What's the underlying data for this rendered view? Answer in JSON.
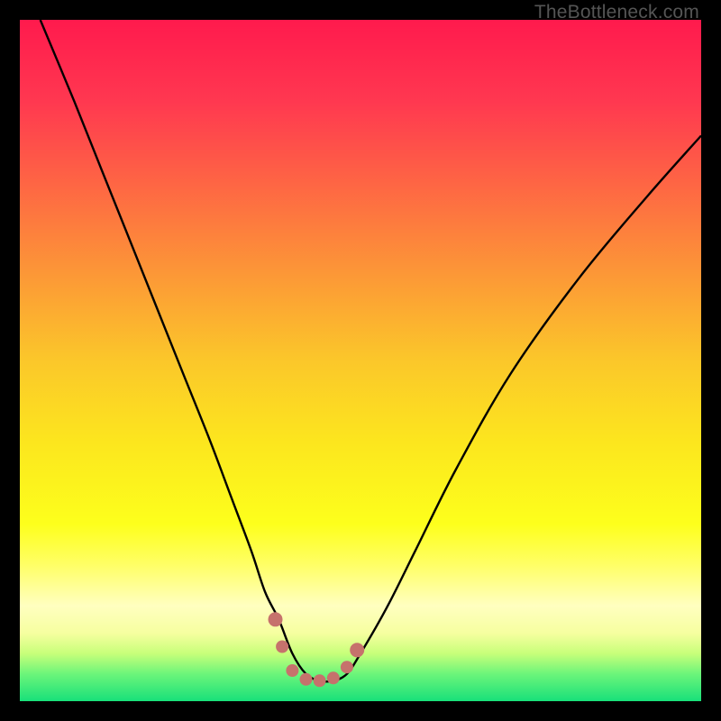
{
  "watermark": "TheBottleneck.com",
  "colors": {
    "frame": "#000000",
    "curve": "#000000",
    "marker": "#C6726C",
    "gradient_stops": [
      {
        "offset": 0.0,
        "color": "#FF1A4D"
      },
      {
        "offset": 0.12,
        "color": "#FF3850"
      },
      {
        "offset": 0.3,
        "color": "#FD7C3E"
      },
      {
        "offset": 0.5,
        "color": "#FBC72A"
      },
      {
        "offset": 0.62,
        "color": "#FCE61E"
      },
      {
        "offset": 0.74,
        "color": "#FDFF1C"
      },
      {
        "offset": 0.8,
        "color": "#FFFF66"
      },
      {
        "offset": 0.86,
        "color": "#FFFFC0"
      },
      {
        "offset": 0.9,
        "color": "#F6FFA0"
      },
      {
        "offset": 0.93,
        "color": "#C8FF7A"
      },
      {
        "offset": 0.96,
        "color": "#6CF57A"
      },
      {
        "offset": 1.0,
        "color": "#18E07A"
      }
    ]
  },
  "chart_data": {
    "type": "line",
    "title": "",
    "xlabel": "",
    "ylabel": "",
    "xlim": [
      0,
      100
    ],
    "ylim": [
      0,
      100
    ],
    "grid": false,
    "legend": false,
    "series": [
      {
        "name": "bottleneck-curve",
        "x": [
          3,
          8,
          12,
          16,
          20,
          24,
          28,
          31,
          34,
          36,
          38,
          40,
          42,
          44,
          46,
          48,
          50,
          54,
          58,
          64,
          72,
          82,
          92,
          100
        ],
        "y": [
          100,
          88,
          78,
          68,
          58,
          48,
          38,
          30,
          22,
          16,
          12,
          7,
          4,
          3,
          3,
          4,
          7,
          14,
          22,
          34,
          48,
          62,
          74,
          83
        ]
      }
    ],
    "markers": {
      "name": "valley-dots",
      "color": "#C6726C",
      "radius_main": 7,
      "radius_end": 8,
      "points": [
        {
          "x": 37.5,
          "y": 12
        },
        {
          "x": 38.5,
          "y": 8
        },
        {
          "x": 40.0,
          "y": 4.5
        },
        {
          "x": 42.0,
          "y": 3.2
        },
        {
          "x": 44.0,
          "y": 3.0
        },
        {
          "x": 46.0,
          "y": 3.4
        },
        {
          "x": 48.0,
          "y": 5.0
        },
        {
          "x": 49.5,
          "y": 7.5
        }
      ]
    },
    "green_band": {
      "y_bottom": 0,
      "y_top": 5
    }
  }
}
